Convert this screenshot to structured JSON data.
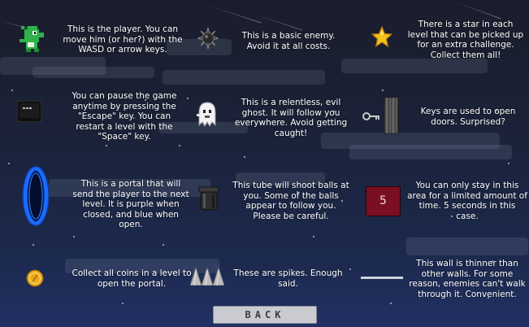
{
  "entries": [
    {
      "id": "player",
      "icon": "green-dinosaur-player-icon",
      "text": "This is the player. You can\nmove him (or her?) with the\nWASD or arrow keys."
    },
    {
      "id": "enemy",
      "icon": "spiked-mine-enemy-icon",
      "text": "This is a basic enemy.\nAvoid it at all costs."
    },
    {
      "id": "star",
      "icon": "gold-star-icon",
      "text": "There is a star in each\nlevel that can be picked up\nfor an extra challenge.\nCollect them all!"
    },
    {
      "id": "pause",
      "icon": "escape-key-icon",
      "text": "You can pause the game\nanytime by pressing the\n\"Escape\" key. You can\nrestart a level with the\n\"Space\" key."
    },
    {
      "id": "ghost",
      "icon": "ghost-icon",
      "text": "This is a relentless, evil\nghost. It will follow you\neverywhere. Avoid getting\ncaught!"
    },
    {
      "id": "keys",
      "icon": "key-and-door-icon",
      "text": "Keys are used to open\ndoors. Surprised?"
    },
    {
      "id": "portal",
      "icon": "blue-portal-icon",
      "text": "This is a portal that will\nsend the player to the next\nlevel. It is purple when\nclosed, and blue when\nopen."
    },
    {
      "id": "tube",
      "icon": "cannon-tube-icon",
      "text": "This tube will shoot balls at\nyou. Some of the  balls\nappear to follow you.\nPlease be careful."
    },
    {
      "id": "timer",
      "icon": "timer-zone-icon",
      "timer_value": "5",
      "text": "You can only stay in this\narea for a limited amount of\ntime. 5 seconds in this\ncase."
    },
    {
      "id": "coin",
      "icon": "gold-coin-icon",
      "text": "Collect all coins in a level to\nopen the portal."
    },
    {
      "id": "spikes",
      "icon": "spikes-icon",
      "text": "These are spikes. Enough\nsaid."
    },
    {
      "id": "thin-wall",
      "icon": "thin-wall-icon",
      "text": "This wall is thinner than\nother walls. For some\nreason, enemies can't walk\nthrough it. Convenient."
    }
  ],
  "back_button": {
    "label": "BACK"
  },
  "colors": {
    "background_top": "#1a1d2b",
    "background_bottom": "#223164",
    "timer_box": "#7a0f22",
    "button": "#c9cbd1"
  }
}
